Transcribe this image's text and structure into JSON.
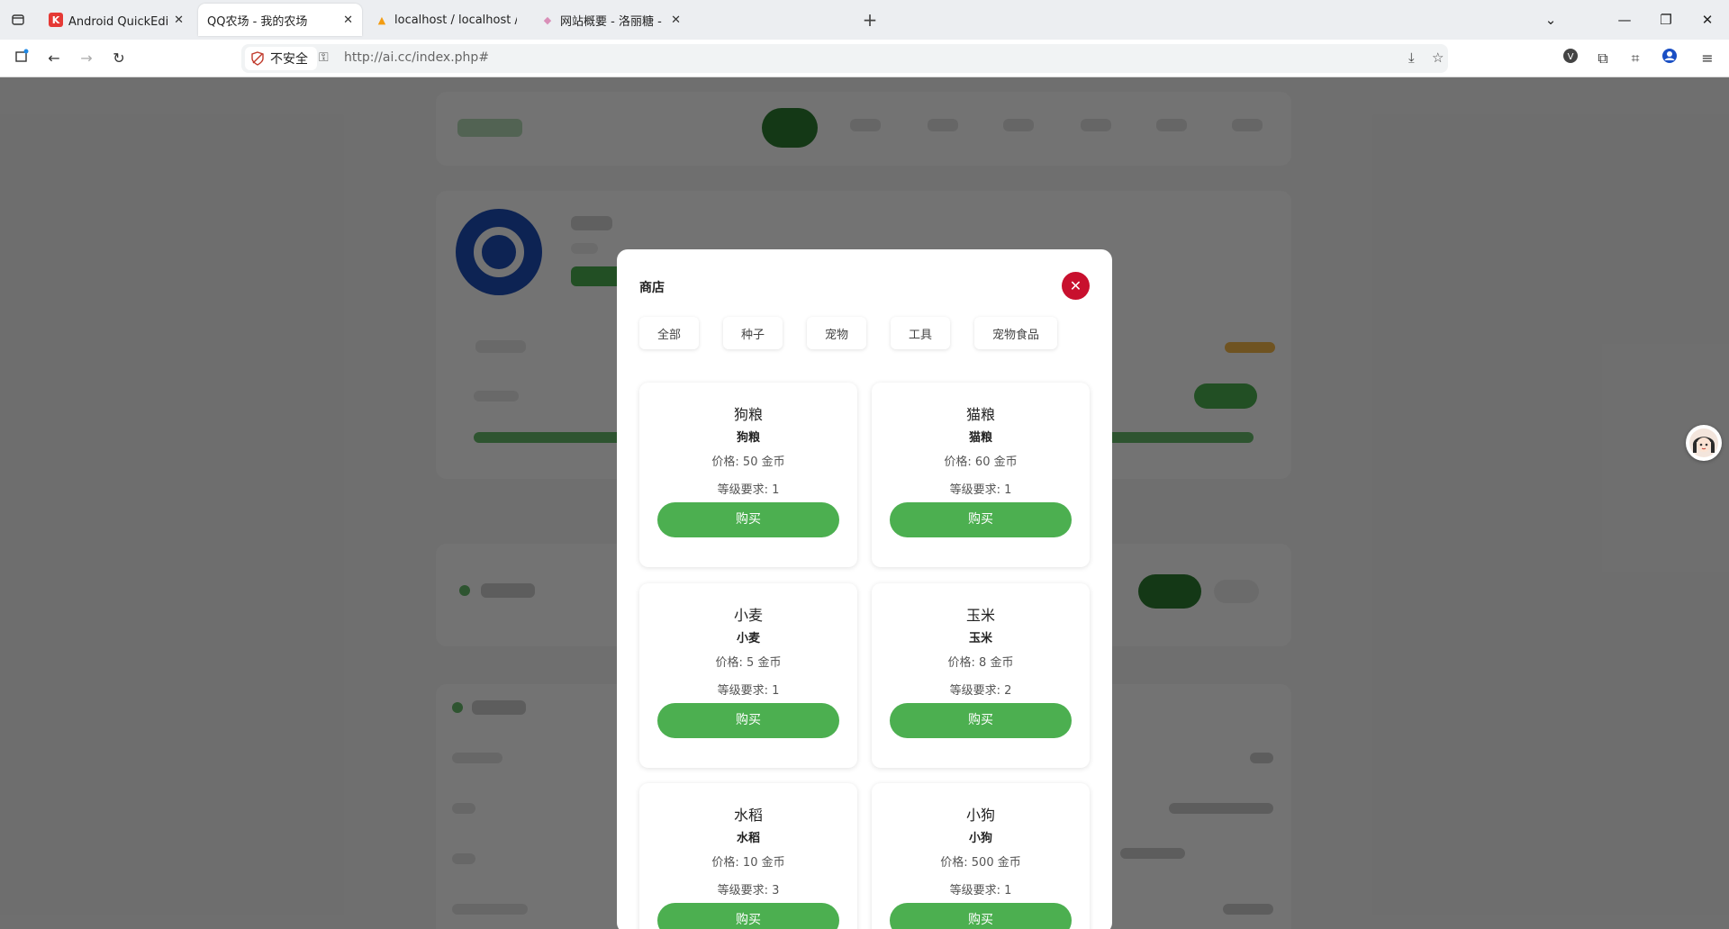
{
  "browser": {
    "tabs": [
      {
        "title": "Android QuickEdit编辑器 - 酷",
        "favicon_color": "#e53935",
        "favicon_glyph": "K",
        "active": false
      },
      {
        "title": "QQ农场 - 我的农场",
        "favicon_color": "",
        "favicon_glyph": "",
        "active": true
      },
      {
        "title": "localhost / localhost / xx | ph",
        "favicon_color": "#f39c12",
        "favicon_glyph": "▲",
        "active": false
      },
      {
        "title": "网站概要 - 洛丽糖 - Powered b",
        "favicon_color": "#d98fb8",
        "favicon_glyph": "◆",
        "active": false
      }
    ],
    "security_label": "不安全",
    "url": "http://ai.cc/index.php#"
  },
  "colors": {
    "accent_green": "#4caf50",
    "close_red": "#c8102e",
    "overlay": "rgba(0,0,0,0.55)"
  },
  "shop": {
    "title": "商店",
    "close_glyph": "✕",
    "filters": [
      "全部",
      "种子",
      "宠物",
      "工具",
      "宠物食品"
    ],
    "items": [
      {
        "name": "狗粮",
        "subtitle": "狗粮",
        "price": "价格: 50 金币",
        "level": "等级要求: 1",
        "buy": "购买"
      },
      {
        "name": "猫粮",
        "subtitle": "猫粮",
        "price": "价格: 60 金币",
        "level": "等级要求: 1",
        "buy": "购买"
      },
      {
        "name": "小麦",
        "subtitle": "小麦",
        "price": "价格: 5 金币",
        "level": "等级要求: 1",
        "buy": "购买"
      },
      {
        "name": "玉米",
        "subtitle": "玉米",
        "price": "价格: 8 金币",
        "level": "等级要求: 2",
        "buy": "购买"
      },
      {
        "name": "水稻",
        "subtitle": "水稻",
        "price": "价格: 10 金币",
        "level": "等级要求: 3",
        "buy": "购买"
      },
      {
        "name": "小狗",
        "subtitle": "小狗",
        "price": "价格: 500 金币",
        "level": "等级要求: 1",
        "buy": "购买"
      }
    ]
  }
}
